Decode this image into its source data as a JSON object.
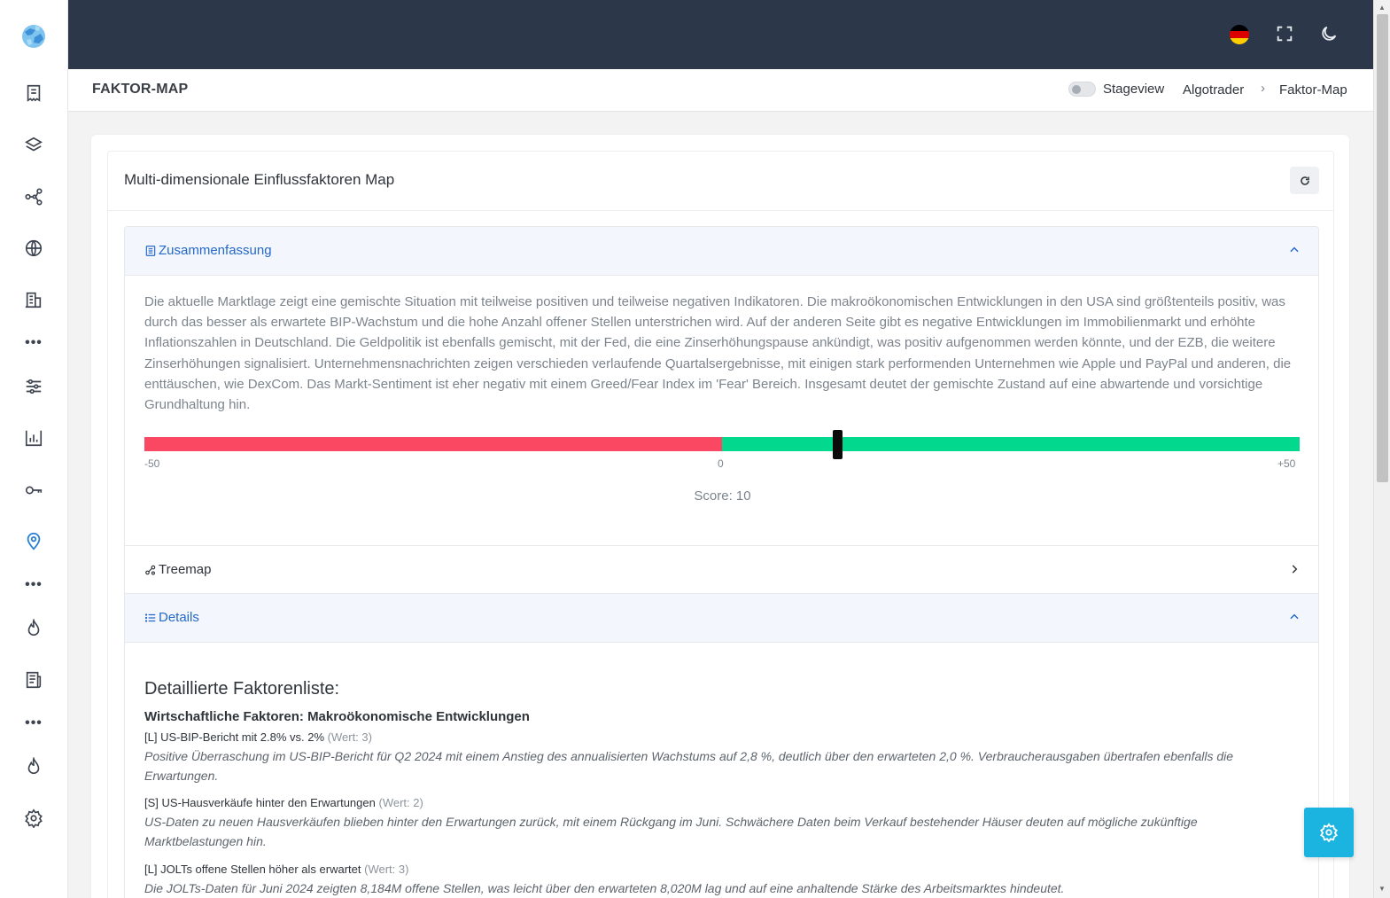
{
  "sidebar": {
    "logo": "globe-logo",
    "items": [
      {
        "name": "sidebar-item-dashboard",
        "icon": "receipt-icon"
      },
      {
        "name": "sidebar-item-layers",
        "icon": "layers-icon"
      },
      {
        "name": "sidebar-item-network",
        "icon": "share-nodes-icon"
      },
      {
        "name": "sidebar-item-globe",
        "icon": "globe-icon"
      },
      {
        "name": "sidebar-item-reports",
        "icon": "building-doc-icon"
      },
      {
        "name": "sidebar-item-filters",
        "icon": "sliders-icon"
      },
      {
        "name": "sidebar-item-analytics",
        "icon": "bar-chart-icon"
      },
      {
        "name": "sidebar-item-keys",
        "icon": "key-icon"
      },
      {
        "name": "sidebar-item-faktor-map",
        "icon": "map-pin-icon",
        "active": true
      },
      {
        "name": "sidebar-item-hot",
        "icon": "flame-icon"
      },
      {
        "name": "sidebar-item-news",
        "icon": "newspaper-icon"
      },
      {
        "name": "sidebar-item-hot-2",
        "icon": "flame-icon"
      },
      {
        "name": "sidebar-item-settings",
        "icon": "gear-icon"
      }
    ]
  },
  "topbar": {
    "flag": "germany-flag-icon",
    "flag_colors": [
      "#000000",
      "#dd0000",
      "#ffce00"
    ],
    "fullscreen_icon": "fullscreen-icon",
    "theme_icon": "moon-icon"
  },
  "pagehead": {
    "title": "FAKTOR-MAP",
    "stageview_label": "Stageview",
    "breadcrumb": [
      "Algotrader",
      "Faktor-Map"
    ],
    "breadcrumb_separator": "›"
  },
  "card": {
    "title": "Multi-dimensionale Einflussfaktoren Map",
    "refresh_icon": "refresh-icon"
  },
  "summary": {
    "label": "Zusammenfassung",
    "text": "Die aktuelle Marktlage zeigt eine gemischte Situation mit teilweise positiven und teilweise negativen Indikatoren. Die makroökonomischen Entwicklungen in den USA sind größtenteils positiv, was durch das besser als erwartete BIP-Wachstum und die hohe Anzahl offener Stellen unterstrichen wird. Auf der anderen Seite gibt es negative Entwicklungen im Immobilienmarkt und erhöhte Inflationszahlen in Deutschland. Die Geldpolitik ist ebenfalls gemischt, mit der Fed, die eine Zinserhöhungspause ankündigt, was positiv aufgenommen werden könnte, und der EZB, die weitere Zinserhöhungen signalisiert. Unternehmensnachrichten zeigen verschieden verlaufende Quartalsergebnisse, mit einigen stark performenden Unternehmen wie Apple und PayPal und anderen, die enttäuschen, wie DexCom. Das Markt-Sentiment ist eher negativ mit einem Greed/Fear Index im 'Fear' Bereich. Insgesamt deutet der gemischte Zustand auf eine abwartende und vorsichtige Grundhaltung hin.",
    "gauge": {
      "min": -50,
      "max": 50,
      "score": 10,
      "min_label": "-50",
      "mid_label": "0",
      "max_label": "+50",
      "negative_color": "#fa4762",
      "positive_color": "#02d98f"
    },
    "score_label": "Score: 10"
  },
  "treemap": {
    "label": "Treemap"
  },
  "details": {
    "label": "Details",
    "heading": "Detaillierte Faktorenliste:",
    "subheading": "Wirtschaftliche Faktoren: Makroökonomische Entwicklungen",
    "factors": [
      {
        "title": "[L] US-BIP-Bericht mit 2.8% vs. 2%",
        "wert": "(Wert: 3)",
        "desc": "Positive Überraschung im US-BIP-Bericht für Q2 2024 mit einem Anstieg des annualisierten Wachstums auf 2,8 %, deutlich über den erwarteten 2,0 %. Verbraucherausgaben übertrafen ebenfalls die Erwartungen."
      },
      {
        "title": "[S] US-Hausverkäufe hinter den Erwartungen",
        "wert": "(Wert: 2)",
        "desc": "US-Daten zu neuen Hausverkäufen blieben hinter den Erwartungen zurück, mit einem Rückgang im Juni. Schwächere Daten beim Verkauf bestehender Häuser deuten auf mögliche zukünftige Marktbelastungen hin."
      },
      {
        "title": "[L] JOLTs offene Stellen höher als erwartet",
        "wert": "(Wert: 3)",
        "desc": "Die JOLTs-Daten für Juni 2024 zeigten 8,184M offene Stellen, was leicht über den erwarteten 8,020M lag und auf eine anhaltende Stärke des Arbeitsmarktes hindeutet."
      }
    ]
  },
  "fab": {
    "icon": "gear-icon"
  }
}
